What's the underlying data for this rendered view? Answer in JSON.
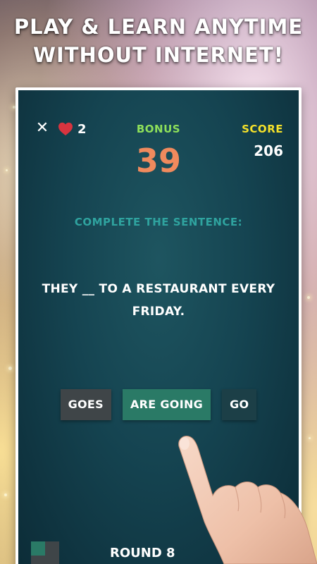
{
  "headline": {
    "line1": "PLAY & LEARN ANYTIME",
    "line2": "WITHOUT INTERNET!"
  },
  "game": {
    "close_icon": "close-icon",
    "lives": {
      "icon": "heart-icon",
      "count": "2"
    },
    "bonus": {
      "label": "BONUS",
      "value": "39"
    },
    "score": {
      "label": "SCORE",
      "value": "206"
    },
    "instruction": "COMPLETE THE SENTENCE:",
    "sentence": {
      "before": "THEY ",
      "blank": "__",
      "after": " TO A RESTAURANT EVERY FRIDAY."
    },
    "options": [
      {
        "label": "GOES"
      },
      {
        "label": "ARE GOING"
      },
      {
        "label": "GO"
      }
    ],
    "round_label": "ROUND 8"
  },
  "colors": {
    "bonus_label": "#8ee05a",
    "bonus_value": "#f08a5d",
    "score_label": "#f5e12a",
    "instruction": "#2fa39f",
    "heart": "#d8343f",
    "screen_bg": "#154451"
  }
}
